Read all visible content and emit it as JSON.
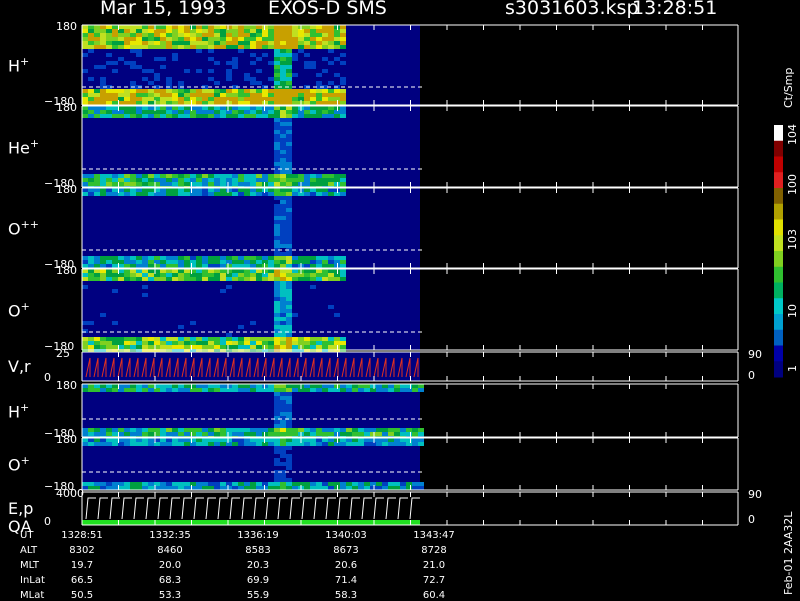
{
  "header": {
    "date": "Mar 15, 1993",
    "instrument": "EXOS-D SMS",
    "file": "s3031603.ksp",
    "time": "13:28:51"
  },
  "panels": [
    {
      "label": "H",
      "sup": "+",
      "ymax": "180",
      "ymin": "−180"
    },
    {
      "label": "He",
      "sup": "+",
      "ymax": "180",
      "ymin": "−180"
    },
    {
      "label": "O",
      "sup": "++",
      "ymax": "180",
      "ymin": "−180"
    },
    {
      "label": "O",
      "sup": "+",
      "ymax": "180",
      "ymin": "−180"
    },
    {
      "label": "V,r",
      "sup": "",
      "ymax": "25",
      "ymin": "0",
      "rmax": "90",
      "rmin": "0"
    },
    {
      "label": "H",
      "sup": "+",
      "ymax": "180",
      "ymin": "−180"
    },
    {
      "label": "O",
      "sup": "+",
      "ymax": "180",
      "ymin": "−180"
    },
    {
      "label": "E,p",
      "label2": "QA",
      "sup": "",
      "ymax": "4000",
      "ymin": "0",
      "rmax": "90",
      "rmin": "0"
    }
  ],
  "colorbar": {
    "unit": "Ct/Smp",
    "ticks": [
      "10",
      "100",
      "10",
      "10",
      "1"
    ],
    "tick_exps": [
      "4",
      "",
      "3",
      "",
      ""
    ],
    "colors": [
      "#000080",
      "#0000a8",
      "#0060c0",
      "#00a0d0",
      "#00c8c8",
      "#00b060",
      "#30c030",
      "#80d020",
      "#c0e020",
      "#e0e000",
      "#b0a000",
      "#806000",
      "#e02020",
      "#c00000",
      "#800000",
      "#ffffff"
    ]
  },
  "table": {
    "rows": [
      "UT",
      "ALT",
      "MLT",
      "InLat",
      "MLat"
    ],
    "cols": [
      [
        "1328:51",
        "8302",
        "19.7",
        "66.5",
        "50.5"
      ],
      [
        "1332:35",
        "8460",
        "20.0",
        "68.3",
        "53.3"
      ],
      [
        "1336:19",
        "8583",
        "20.3",
        "69.9",
        "55.9"
      ],
      [
        "1340:03",
        "8673",
        "20.6",
        "71.4",
        "58.3"
      ],
      [
        "1343:47",
        "8728",
        "21.0",
        "72.7",
        "60.4"
      ]
    ]
  },
  "footer": "Feb-01 2AA32L",
  "chart_data": {
    "type": "heatmap",
    "title": "Mar 15, 1993   EXOS-D SMS   s3031603.ksp  13:28:51",
    "x": [
      "1328:51",
      "1332:35",
      "1336:19",
      "1340:03",
      "1343:47"
    ],
    "panels": [
      "H+",
      "He+",
      "O++",
      "O+",
      "V,r",
      "H+",
      "O+",
      "E,p QA"
    ],
    "ylim_pitch": [
      -180,
      180
    ],
    "ylim_V": [
      0,
      25
    ],
    "ylim_E": [
      0,
      4000
    ],
    "colorbar_unit": "Ct/Smp",
    "colorbar_range": [
      1,
      10000
    ]
  }
}
